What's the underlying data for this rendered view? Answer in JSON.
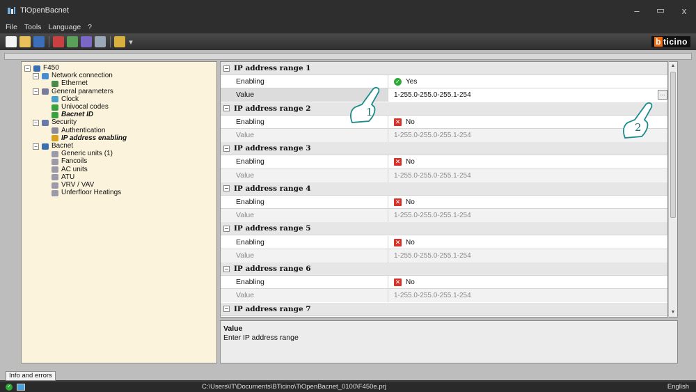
{
  "window": {
    "title": "TiOpenBacnet",
    "minimize": "–",
    "maximize": "▭",
    "close": "x"
  },
  "menu": [
    "File",
    "Tools",
    "Language",
    "?"
  ],
  "brand": {
    "first": "b",
    "rest": "ticino"
  },
  "tree": [
    {
      "label": "F450",
      "level": 0,
      "exp": "−",
      "icon": "device-icon",
      "style": "normal"
    },
    {
      "label": "Network connection",
      "level": 1,
      "exp": "−",
      "icon": "network-icon",
      "style": "normal"
    },
    {
      "label": "Ethernet",
      "level": 2,
      "exp": "",
      "icon": "ethernet-icon",
      "style": "normal"
    },
    {
      "label": "General parameters",
      "level": 1,
      "exp": "−",
      "icon": "settings-icon",
      "style": "normal"
    },
    {
      "label": "Clock",
      "level": 2,
      "exp": "",
      "icon": "clock-icon",
      "style": "normal"
    },
    {
      "label": "Univocal codes",
      "level": 2,
      "exp": "",
      "icon": "code-icon",
      "style": "normal"
    },
    {
      "label": "Bacnet ID",
      "level": 2,
      "exp": "",
      "icon": "id-icon",
      "style": "bold-italic"
    },
    {
      "label": "Security",
      "level": 1,
      "exp": "−",
      "icon": "shield-icon",
      "style": "normal"
    },
    {
      "label": "Authentication",
      "level": 2,
      "exp": "",
      "icon": "key-icon",
      "style": "normal"
    },
    {
      "label": "IP address enabling",
      "level": 2,
      "exp": "",
      "icon": "lock-icon",
      "style": "bold-italic"
    },
    {
      "label": "Bacnet",
      "level": 1,
      "exp": "−",
      "icon": "bacnet-icon",
      "style": "normal"
    },
    {
      "label": "Generic units (1)",
      "level": 2,
      "exp": "",
      "icon": "unit-icon",
      "style": "normal"
    },
    {
      "label": "Fancoils",
      "level": 2,
      "exp": "",
      "icon": "unit-icon",
      "style": "normal"
    },
    {
      "label": "AC units",
      "level": 2,
      "exp": "",
      "icon": "unit-icon",
      "style": "normal"
    },
    {
      "label": "ATU",
      "level": 2,
      "exp": "",
      "icon": "unit-icon",
      "style": "normal"
    },
    {
      "label": "VRV / VAV",
      "level": 2,
      "exp": "",
      "icon": "unit-icon",
      "style": "normal"
    },
    {
      "label": "Unferfloor Heatings",
      "level": 2,
      "exp": "",
      "icon": "unit-icon",
      "style": "normal"
    }
  ],
  "grid": {
    "enabling_label": "Enabling",
    "value_label": "Value",
    "yes": "Yes",
    "no": "No",
    "ellipsis": "...",
    "ranges": [
      {
        "title": "IP address range 1",
        "enabled": true,
        "value": "1-255.0-255.0-255.1-254"
      },
      {
        "title": "IP address range 2",
        "enabled": false,
        "value": "1-255.0-255.0-255.1-254"
      },
      {
        "title": "IP address range 3",
        "enabled": false,
        "value": "1-255.0-255.0-255.1-254"
      },
      {
        "title": "IP address range 4",
        "enabled": false,
        "value": "1-255.0-255.0-255.1-254"
      },
      {
        "title": "IP address range 5",
        "enabled": false,
        "value": "1-255.0-255.0-255.1-254"
      },
      {
        "title": "IP address range 6",
        "enabled": false,
        "value": "1-255.0-255.0-255.1-254"
      },
      {
        "title": "IP address range 7",
        "enabled": false,
        "value": ""
      }
    ]
  },
  "description": {
    "title": "Value",
    "text": "Enter IP address range"
  },
  "info_button": "Info and errors",
  "status": {
    "path": "C:\\Users\\IT\\Documents\\BTicino\\TiOpenBacnet_0100\\F450e.prj",
    "language": "English"
  },
  "callouts": [
    "1",
    "2"
  ]
}
